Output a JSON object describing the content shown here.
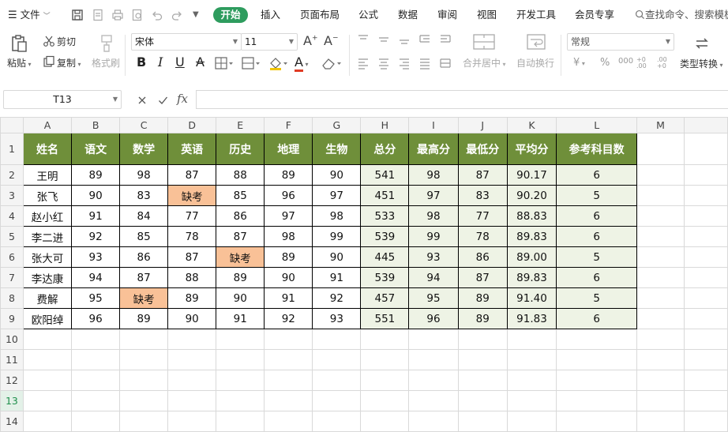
{
  "menu": {
    "file": "文件",
    "tabs": [
      "开始",
      "插入",
      "页面布局",
      "公式",
      "数据",
      "审阅",
      "视图",
      "开发工具",
      "会员专享"
    ],
    "search": "查找命令、搜索模板"
  },
  "ribbon": {
    "paste": "粘贴",
    "cut": "剪切",
    "copy": "复制",
    "format_painter": "格式刷",
    "font_name": "宋体",
    "font_size": "11",
    "merge_center": "合并居中",
    "wrap_text": "自动换行",
    "number_format": "常规",
    "type_convert": "类型转换",
    "bold": "B",
    "italic": "I",
    "underline": "U",
    "strike": "A",
    "font_color": "A",
    "grow_font": "A",
    "shrink_font": "A",
    "currency": "¥",
    "percent": "%",
    "thousands": "000",
    "inc_decimal": "+0 .00",
    "dec_decimal": ".00 +0"
  },
  "formula_bar": {
    "name_box": "T13",
    "fx": "fx",
    "value": ""
  },
  "sheet": {
    "columns": [
      "A",
      "B",
      "C",
      "D",
      "E",
      "F",
      "G",
      "H",
      "I",
      "J",
      "K",
      "L",
      "M"
    ],
    "row_numbers": [
      "1",
      "2",
      "3",
      "4",
      "5",
      "6",
      "7",
      "8",
      "9",
      "10",
      "11",
      "12",
      "13",
      "14"
    ],
    "active_row": "13",
    "headers": [
      "姓名",
      "语文",
      "数学",
      "英语",
      "历史",
      "地理",
      "生物",
      "总分",
      "最高分",
      "最低分",
      "平均分",
      "参考科目数"
    ],
    "rows": [
      [
        "王明",
        "89",
        "98",
        "87",
        "88",
        "89",
        "90",
        "541",
        "98",
        "87",
        "90.17",
        "6"
      ],
      [
        "张飞",
        "90",
        "83",
        "缺考",
        "85",
        "96",
        "97",
        "451",
        "97",
        "83",
        "90.20",
        "5"
      ],
      [
        "赵小红",
        "91",
        "84",
        "77",
        "86",
        "97",
        "98",
        "533",
        "98",
        "77",
        "88.83",
        "6"
      ],
      [
        "李二进",
        "92",
        "85",
        "78",
        "87",
        "98",
        "99",
        "539",
        "99",
        "78",
        "89.83",
        "6"
      ],
      [
        "张大可",
        "93",
        "86",
        "87",
        "缺考",
        "89",
        "90",
        "445",
        "93",
        "86",
        "89.00",
        "5"
      ],
      [
        "李达康",
        "94",
        "87",
        "88",
        "89",
        "90",
        "91",
        "539",
        "94",
        "87",
        "89.83",
        "6"
      ],
      [
        "费解",
        "95",
        "缺考",
        "89",
        "90",
        "91",
        "92",
        "457",
        "95",
        "89",
        "91.40",
        "5"
      ],
      [
        "欧阳绰",
        "96",
        "89",
        "90",
        "91",
        "92",
        "93",
        "551",
        "96",
        "89",
        "91.83",
        "6"
      ]
    ],
    "absent_value": "缺考",
    "colors": {
      "header_fill": "#6f8f3a",
      "calc_fill": "#eef3e5",
      "absent_fill": "#f9c197",
      "accent": "#2e9c5e"
    }
  }
}
